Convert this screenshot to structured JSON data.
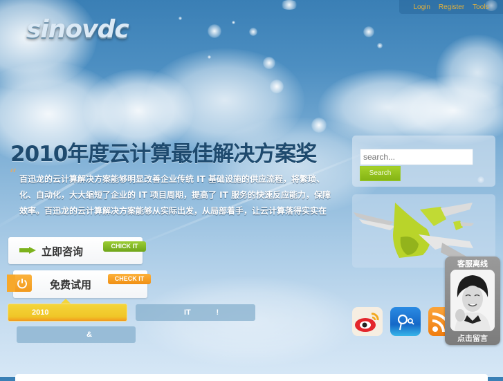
{
  "topnav": {
    "items": [
      {
        "label": "Login"
      },
      {
        "label": "Register"
      },
      {
        "label": "Tools"
      }
    ]
  },
  "logo": {
    "text": "sinovdc"
  },
  "hero": {
    "headline": "2010年度云计算最佳解决方案奖",
    "quote_mark": "“",
    "description_lines": [
      "百迅龙的云计算解决方案能够明显改善企业传统 IT 基础设施的供应流程，将繁琐、",
      "化、自动化，大大缩短了企业的 IT 项目周期，提高了 IT 服务的快速反应能力，保障",
      "效率。百迅龙的云计算解决方案能够从实际出发，从局部着手，让云计算落得实实在"
    ]
  },
  "cta": {
    "consult": {
      "label": "立即咨询",
      "button": "CHICK IT",
      "icon": "arrow-right-icon"
    },
    "trial": {
      "label": "免费试用",
      "button": "CHECK IT",
      "icon": "power-icon"
    }
  },
  "tabs": [
    {
      "label": "2010",
      "active": true
    },
    {
      "label": "IT            !",
      "active": false
    },
    {
      "label": "&",
      "active": false
    }
  ],
  "search": {
    "placeholder": "search...",
    "button": "Search"
  },
  "social": [
    {
      "name": "weibo",
      "icon": "weibo-icon"
    },
    {
      "name": "qq",
      "icon": "qq-icon"
    },
    {
      "name": "rss",
      "icon": "rss-icon"
    }
  ],
  "service": {
    "status": "客服离线",
    "action": "点击留言"
  },
  "colors": {
    "nav_link": "#e3b13b",
    "headline": "#1e4a6e",
    "green_button": "#84b414",
    "orange_button": "#f29a1d",
    "active_tab": "#f0c628",
    "inactive_tab": "#9bbdd6"
  }
}
